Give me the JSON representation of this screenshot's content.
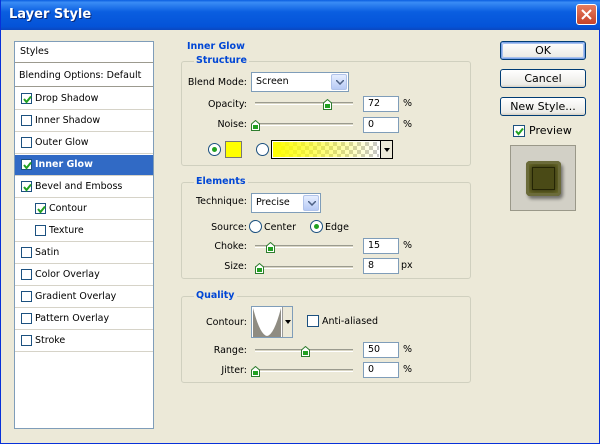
{
  "window": {
    "title": "Layer Style",
    "close_glyph": "close-icon"
  },
  "styles_list": {
    "header": "Styles",
    "blending": "Blending Options: Default",
    "items": [
      {
        "label": "Drop Shadow",
        "checked": true,
        "active": false,
        "indent": 0
      },
      {
        "label": "Inner Shadow",
        "checked": false,
        "active": false,
        "indent": 0
      },
      {
        "label": "Outer Glow",
        "checked": false,
        "active": false,
        "indent": 0
      },
      {
        "label": "Inner Glow",
        "checked": true,
        "active": true,
        "indent": 0
      },
      {
        "label": "Bevel and Emboss",
        "checked": true,
        "active": false,
        "indent": 0
      },
      {
        "label": "Contour",
        "checked": true,
        "active": false,
        "indent": 1
      },
      {
        "label": "Texture",
        "checked": false,
        "active": false,
        "indent": 1
      },
      {
        "label": "Satin",
        "checked": false,
        "active": false,
        "indent": 0
      },
      {
        "label": "Color Overlay",
        "checked": false,
        "active": false,
        "indent": 0
      },
      {
        "label": "Gradient Overlay",
        "checked": false,
        "active": false,
        "indent": 0
      },
      {
        "label": "Pattern Overlay",
        "checked": false,
        "active": false,
        "indent": 0
      },
      {
        "label": "Stroke",
        "checked": false,
        "active": false,
        "indent": 0
      }
    ]
  },
  "inner_glow": {
    "title": "Inner Glow",
    "structure": {
      "title": "Structure",
      "blend_mode_label": "Blend Mode:",
      "blend_mode_value": "Screen",
      "opacity_label": "Opacity:",
      "opacity_value": "72",
      "opacity_unit": "%",
      "opacity_fraction": 0.72,
      "noise_label": "Noise:",
      "noise_value": "0",
      "noise_unit": "%",
      "noise_fraction": 0.0,
      "color_swatch": "#ffff00",
      "use_color": true
    },
    "elements": {
      "title": "Elements",
      "technique_label": "Technique:",
      "technique_value": "Precise",
      "source_label": "Source:",
      "source_center": "Center",
      "source_edge": "Edge",
      "source_selected": "Edge",
      "choke_label": "Choke:",
      "choke_value": "15",
      "choke_unit": "%",
      "choke_fraction": 0.15,
      "size_label": "Size:",
      "size_value": "8",
      "size_unit": "px",
      "size_fraction": 0.04
    },
    "quality": {
      "title": "Quality",
      "contour_label": "Contour:",
      "anti_aliased_label": "Anti-aliased",
      "anti_aliased": false,
      "range_label": "Range:",
      "range_value": "50",
      "range_unit": "%",
      "range_fraction": 0.5,
      "jitter_label": "Jitter:",
      "jitter_value": "0",
      "jitter_unit": "%",
      "jitter_fraction": 0.0
    }
  },
  "buttons": {
    "ok": "OK",
    "cancel": "Cancel",
    "new_style": "New Style...",
    "preview_label": "Preview",
    "preview_checked": true
  },
  "colors": {
    "accent": "#316ac5",
    "group_title": "#0046d5",
    "glow": "#ffff00"
  }
}
